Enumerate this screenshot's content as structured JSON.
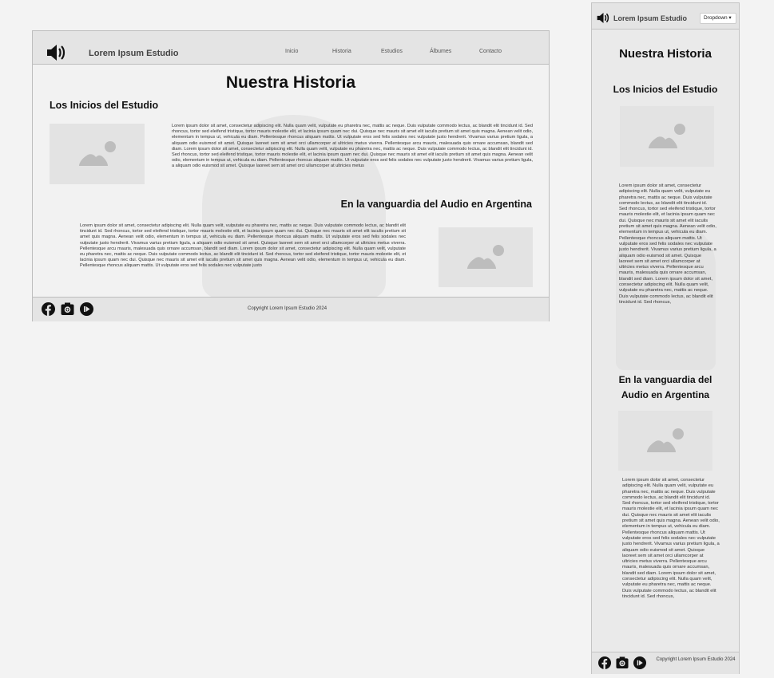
{
  "desktop": {
    "brand": "Lorem Ipsum Estudio",
    "nav": [
      "Inicio",
      "Historia",
      "Estudios",
      "Álbumes",
      "Contacto"
    ],
    "title": "Nuestra Historia",
    "section1_heading": "Los Inicios del Estudio",
    "section2_heading": "En la vanguardia del Audio en Argentina",
    "section1_text": "Lorem ipsum dolor sit amet, consectetur adipiscing elit. Nulla quam velit, vulputate eu pharetra nec, mattis ac neque. Duis vulputate commodo lectus, ac blandit elit tincidunt id. Sed rhoncus, tortor sed eleifend tristique, tortor mauris molestie elit, et lacinia ipsum quam nec dui. Quisque nec mauris sit amet elit iaculis pretium sit amet quis magna. Aenean velit odio, elementum in tempus ut, vehicula eu diam. Pellentesque rhoncus aliquam mattis. Ut vulputate eros sed felis sodales nec vulputate justo hendrerit. Vivamus varius pretium ligula, a aliquam odio euismod sit amet. Quisque laoreet sem sit amet orci ullamcorper at ultricies metus viverra. Pellentesque arcu mauris, malesuada quis ornare accumsan, blandit sed diam. Lorem ipsum dolor sit amet, consectetur adipiscing elit. Nulla quam velit, vulputate eu pharetra nec, mattis ac neque. Duis vulputate commodo lectus, ac blandit elit tincidunt id. Sed rhoncus, tortor sed eleifend tristique, tortor mauris molestie elit, et lacinia ipsum quam nec dui. Quisque nec mauris sit amet elit iaculis pretium sit amet quis magna. Aenean velit odio, elementum in tempus ut, vehicula eu diam. Pellentesque rhoncus aliquam mattis. Ut vulputate eros sed felis sodales nec vulputate justo hendrerit. Vivamus varius pretium ligula, a aliquam odio euismod sit amet. Quisque laoreet sem sit amet orci ullamcorper at ultricies metus",
    "section2_text": "Lorem ipsum dolor sit amet, consectetur adipiscing elit. Nulla quam velit, vulputate eu pharetra nec, mattis ac neque. Duis vulputate commodo lectus, ac blandit elit tincidunt id. Sed rhoncus, tortor sed eleifend tristique, tortor mauris molestie elit, et lacinia ipsum quam nec dui. Quisque nec mauris sit amet elit iaculis pretium sit amet quis magna. Aenean velit odio, elementum in tempus ut, vehicula eu diam. Pellentesque rhoncus aliquam mattis. Ut vulputate eros sed felis sodales nec vulputate justo hendrerit. Vivamus varius pretium ligula, a aliquam odio euismod sit amet. Quisque laoreet sem sit amet orci ullamcorper at ultricies metus viverra. Pellentesque arcu mauris, malesuada quis ornare accumsan, blandit sed diam. Lorem ipsum dolor sit amet, consectetur adipiscing elit. Nulla quam velit, vulputate eu pharetra nec, mattis ac neque. Duis vulputate commodo lectus, ac blandit elit tincidunt id. Sed rhoncus, tortor sed eleifend tristique, tortor mauris molestie elit, et lacinia ipsum quam nec dui. Quisque nec mauris sit amet elit iaculis pretium sit amet quis magna. Aenean velit odio, elementum in tempus ut, vehicula eu diam. Pellentesque rhoncus aliquam mattis. Ut vulputate eros sed felis sodales nec vulputate justo",
    "copyright": "Copyright Lorem Ipsum Estudio 2024"
  },
  "mobile": {
    "brand": "Lorem Ipsum Estudio",
    "dropdown_label": "Dropdown ▾",
    "title": "Nuestra Historia",
    "section1_heading": "Los Inicios del Estudio",
    "section2_heading": "En la vanguardia del Audio en Argentina",
    "section1_text": "Lorem ipsum dolor sit amet, consectetur adipiscing elit. Nulla quam velit, vulputate eu pharetra nec, mattis ac neque. Duis vulputate commodo lectus, ac blandit elit tincidunt id. Sed rhoncus, tortor sed eleifend tristique, tortor mauris molestie elit, et lacinia ipsum quam nec dui. Quisque nec mauris sit amet elit iaculis pretium sit amet quis magna. Aenean velit odio, elementum in tempus ut, vehicula eu diam. Pellentesque rhoncus aliquam mattis. Ut vulputate eros sed felis sodales nec vulputate justo hendrerit. Vivamus varius pretium ligula, a aliquam odio euismod sit amet. Quisque laoreet sem sit amet orci ullamcorper at ultricies metus viverra. Pellentesque arcu mauris, malesuada quis ornare accumsan, blandit sed diam. Lorem ipsum dolor sit amet, consectetur adipiscing elit. Nulla quam velit, vulputate eu pharetra nec, mattis ac neque. Duis vulputate commodo lectus, ac blandit elit tincidunt id. Sed rhoncus,",
    "section2_text": "Lorem ipsum dolor sit amet, consectetur adipiscing elit. Nulla quam velit, vulputate eu pharetra nec, mattis ac neque. Duis vulputate commodo lectus, ac blandit elit tincidunt id. Sed rhoncus, tortor sed eleifend tristique, tortor mauris molestie elit, et lacinia ipsum quam nec dui. Quisque nec mauris sit amet elit iaculis pretium sit amet quis magna. Aenean velit odio, elementum in tempus ut, vehicula eu diam. Pellentesque rhoncus aliquam mattis. Ut vulputate eros sed felis sodales nec vulputate justo hendrerit. Vivamus varius pretium ligula, a aliquam odio euismod sit amet. Quisque laoreet sem sit amet orci ullamcorper at ultricies metus viverra. Pellentesque arcu mauris, malesuada quis ornare accumsan, blandit sed diam. Lorem ipsum dolor sit amet, consectetur adipiscing elit. Nulla quam velit, vulputate eu pharetra nec, mattis ac neque. Duis vulputate commodo lectus, ac blandit elit tincidunt id. Sed rhoncus,",
    "copyright": "Copyright Lorem Ipsum Estudio 2024"
  },
  "icons": {
    "logo": "speaker-volume-icon",
    "social": [
      "facebook-icon",
      "instagram-icon",
      "play-icon"
    ],
    "image_placeholder": "image-placeholder-icon"
  },
  "colors": {
    "header_bg": "#e4e4e4",
    "page_bg": "#f2f2f2",
    "placeholder_bg": "#e3e3e3",
    "placeholder_icon": "#bdbdbd"
  }
}
